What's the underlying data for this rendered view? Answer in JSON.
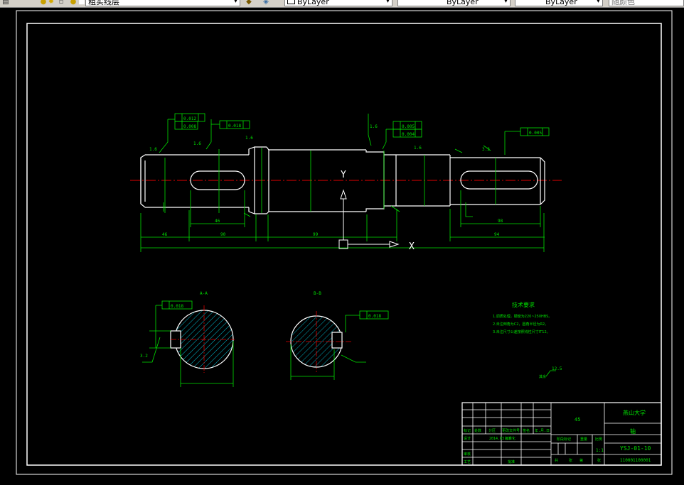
{
  "toolbar": {
    "layer_name": "粗实线层",
    "color_value": "ByLayer",
    "linetype_value": "ByLayer",
    "lineweight_value": "ByLayer",
    "plotstyle_value": "随颜色",
    "icons": [
      "layer-manager-icon",
      "lightbulb-icon",
      "sun-icon",
      "lock-icon",
      "color-square-icon",
      "make-current-icon",
      "layer-previous-icon"
    ]
  },
  "drawing": {
    "tolerances": {
      "t1a": "0.012",
      "t1b": "0.008",
      "t2": "0.018",
      "t3a": "0.005",
      "t3b": "0.004",
      "t4": "0.005",
      "t5": "0.018",
      "t6": "0.018"
    },
    "dims": {
      "d1": "46",
      "d2": "90",
      "d3": "46",
      "d4": "99",
      "d5": "94",
      "d6": "98"
    },
    "roughness": {
      "r1": "1.6",
      "r2": "1.6",
      "r3": "1.6",
      "r4": "1.6",
      "r5": "1.6",
      "r6": "3.2",
      "r7": "3.2",
      "r8": "12.5"
    },
    "section_labels": {
      "a": "A-A",
      "b": "B-B"
    },
    "ucs": {
      "x": "X",
      "y": "Y"
    },
    "tech_req": {
      "title": "技术要求",
      "items": [
        "1.调质处理，硬度为220~250HBS。",
        "2.未注倒角为C2，圆角半径为R2。",
        "3.未注尺寸公差按照线性尺寸IT12。"
      ],
      "rest": "其余"
    },
    "title_block": {
      "material": "45",
      "school": "燕山大学",
      "part_name": "轴",
      "drawing_no": "YSJ-01-10",
      "scale": "1:1",
      "student_no": "110001100001",
      "headers": [
        "标记",
        "处数",
        "分区",
        "更改文件号",
        "签名",
        "年.月.日"
      ],
      "design_label": "设计",
      "design_date": "2014.03.01",
      "design_std": "标准化",
      "review_label": "审核",
      "process_label": "工艺",
      "approve_label": "批准",
      "stage_label": "阶段标记",
      "weight_label": "重量",
      "scale_label": "比例",
      "sheets": [
        "共",
        "张",
        "第",
        "张"
      ]
    }
  }
}
